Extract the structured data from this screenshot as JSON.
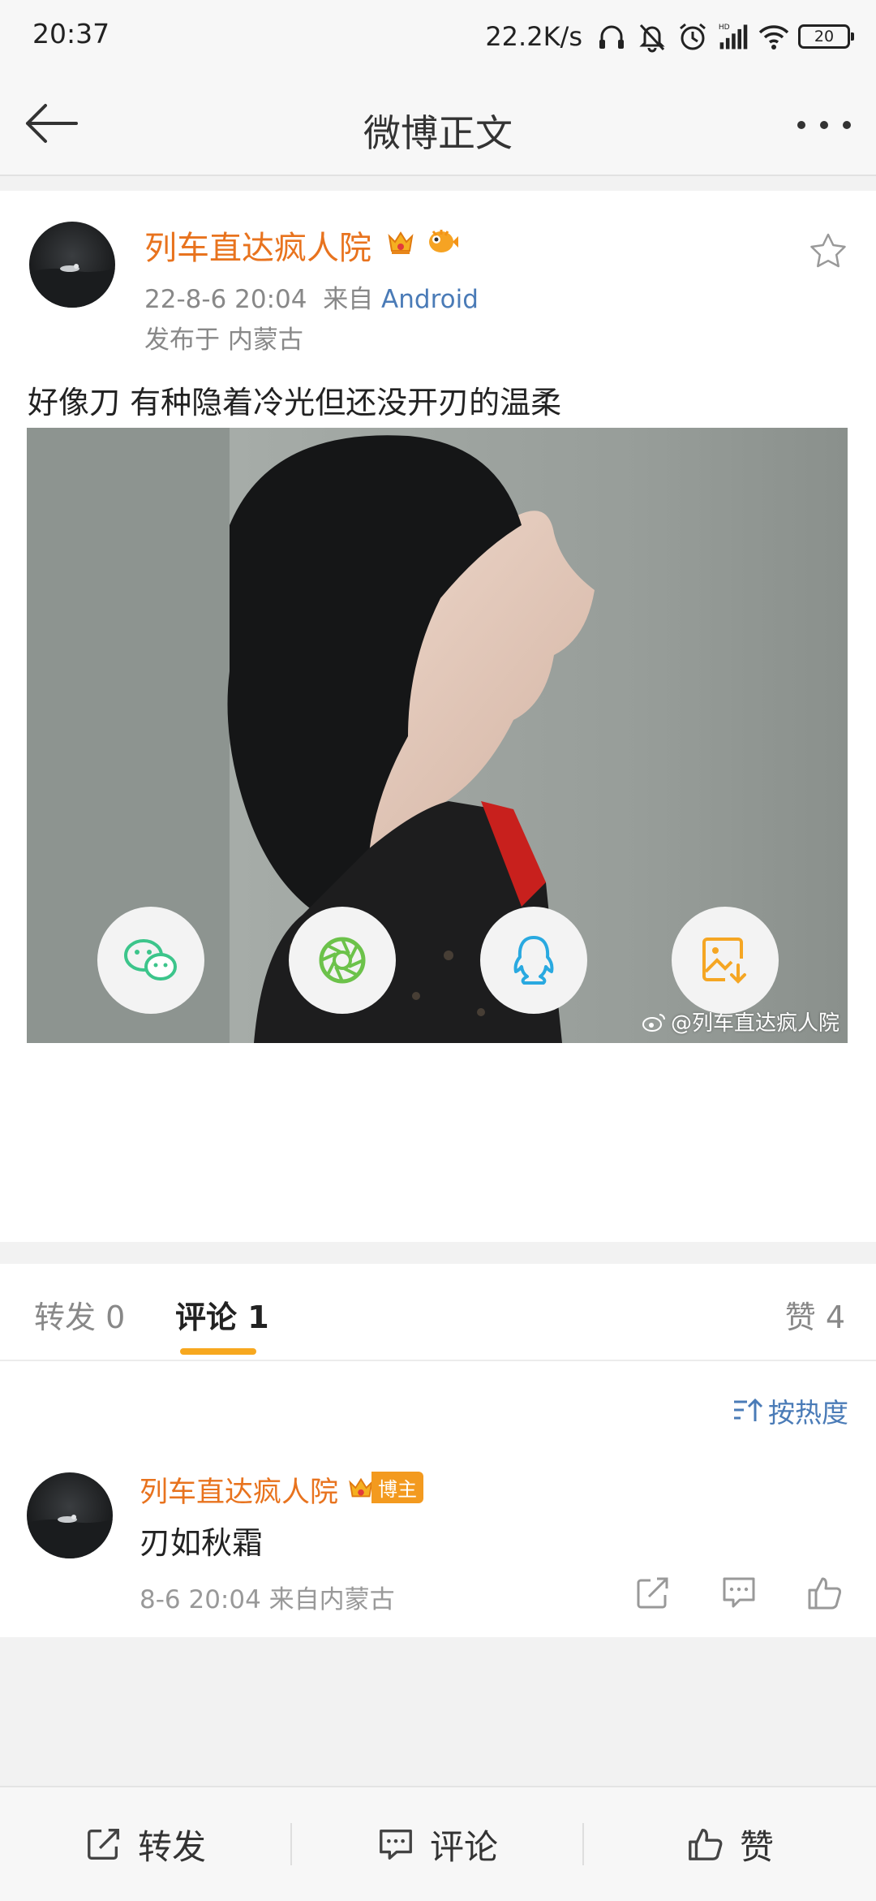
{
  "status_bar": {
    "time": "20:37",
    "net_speed": "22.2K/s",
    "battery": "20",
    "network_label": "HD"
  },
  "nav": {
    "title": "微博正文"
  },
  "post": {
    "author": "列车直达疯人院",
    "date": "22-8-6 20:04",
    "source_prefix": "来自",
    "source": "Android",
    "location": "发布于 内蒙古",
    "text": "好像刀 有种隐着冷光但还没开刃的温柔",
    "image_watermark": "@列车直达疯人院"
  },
  "share_buttons": [
    {
      "icon": "wechat-icon",
      "color": "#3cc58b"
    },
    {
      "icon": "moments-icon",
      "color": "#6cc24a"
    },
    {
      "icon": "qq-icon",
      "color": "#29a9e0"
    },
    {
      "icon": "save-image-icon",
      "color": "#f5a623"
    }
  ],
  "tabs": {
    "repost": "转发 0",
    "comment": "评论 1",
    "like": "赞 4"
  },
  "sort": {
    "label": "按热度"
  },
  "comment": {
    "author": "列车直达疯人院",
    "badge": "博主",
    "text": "刃如秋霜",
    "meta": "8-6 20:04  来自内蒙古"
  },
  "bottom_bar": {
    "repost": "转发",
    "comment": "评论",
    "like": "赞"
  },
  "colors": {
    "accent_orange": "#e8731e",
    "link_blue": "#4a7bb7",
    "tab_underline": "#f7a81f"
  }
}
